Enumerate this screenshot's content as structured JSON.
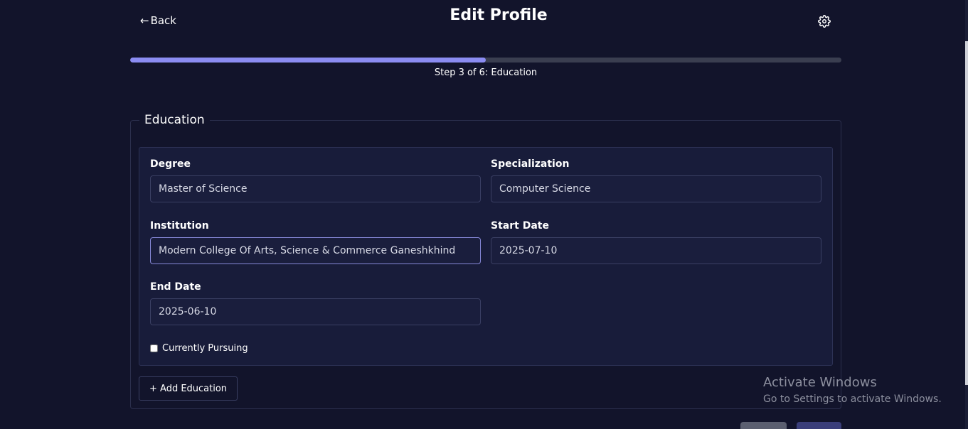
{
  "header": {
    "back_label": "Back",
    "back_arrow": "←",
    "title": "Edit Profile",
    "settings_icon": "gear-icon"
  },
  "progress": {
    "step_text": "Step 3 of 6: Education",
    "fraction": 0.5,
    "fill_color": "#8b8cf2",
    "track_color": "#3a3e50"
  },
  "section": {
    "legend": "Education"
  },
  "education": {
    "degree_label": "Degree",
    "degree_value": "Master of Science",
    "specialization_label": "Specialization",
    "specialization_value": "Computer Science",
    "institution_label": "Institution",
    "institution_value": "Modern College Of Arts, Science & Commerce Ganeshkhind",
    "start_date_label": "Start Date",
    "start_date_value": "2025-07-10",
    "end_date_label": "End Date",
    "end_date_value": "2025-06-10",
    "currently_pursuing_label": "Currently Pursuing",
    "currently_pursuing_checked": false
  },
  "actions": {
    "add_education_label": "+ Add Education"
  },
  "watermark": {
    "title": "Activate Windows",
    "subtitle": "Go to Settings to activate Windows."
  },
  "colors": {
    "background": "#12142b",
    "card": "#181c3a",
    "accent": "#8b8cf2"
  }
}
